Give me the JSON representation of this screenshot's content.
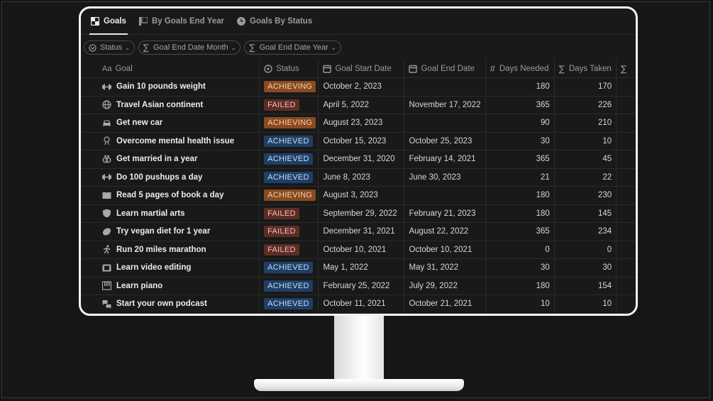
{
  "tabs": [
    {
      "label": "Goals",
      "icon": "table-icon",
      "active": true
    },
    {
      "label": "By Goals End Year",
      "icon": "board-icon",
      "active": false
    },
    {
      "label": "Goals By Status",
      "icon": "clock-icon",
      "active": false
    }
  ],
  "filters": [
    {
      "label": "Status",
      "icon": "status-icon"
    },
    {
      "label": "Goal End Date Month",
      "icon": "sigma-icon"
    },
    {
      "label": "Goal End Date Year",
      "icon": "sigma-icon"
    }
  ],
  "columns": {
    "goal": "Goal",
    "status": "Status",
    "start": "Goal Start Date",
    "end": "Goal End Date",
    "need": "Days Needed",
    "taken": "Days Taken",
    "goal_prefix": "Aa",
    "need_prefix": "#",
    "sigma": "∑"
  },
  "colors": {
    "achieving": "#8a4a1d",
    "achieved": "#1e3f66",
    "failed": "#5e2b26"
  },
  "rows": [
    {
      "icon": "dumbbell-icon",
      "goal": "Gain 10 pounds weight",
      "status": "ACHIEVING",
      "start": "October 2, 2023",
      "end": "",
      "need": "180",
      "taken": "170"
    },
    {
      "icon": "globe-icon",
      "goal": "Travel Asian continent",
      "status": "FAILED",
      "start": "April 5, 2022",
      "end": "November 17, 2022",
      "need": "365",
      "taken": "226"
    },
    {
      "icon": "car-icon",
      "goal": "Get new car",
      "status": "ACHIEVING",
      "start": "August 23, 2023",
      "end": "",
      "need": "90",
      "taken": "210"
    },
    {
      "icon": "brain-icon",
      "goal": "Overcome mental health issue",
      "status": "ACHIEVED",
      "start": "October 15, 2023",
      "end": "October 25, 2023",
      "need": "30",
      "taken": "10"
    },
    {
      "icon": "rings-icon",
      "goal": "Get married in a year",
      "status": "ACHIEVED",
      "start": "December 31, 2020",
      "end": "February 14, 2021",
      "need": "365",
      "taken": "45"
    },
    {
      "icon": "dumbbell-icon",
      "goal": "Do 100 pushups a day",
      "status": "ACHIEVED",
      "start": "June 8, 2023",
      "end": "June 30, 2023",
      "need": "21",
      "taken": "22"
    },
    {
      "icon": "book-icon",
      "goal": "Read 5 pages of book a day",
      "status": "ACHIEVING",
      "start": "August 3, 2023",
      "end": "",
      "need": "180",
      "taken": "230"
    },
    {
      "icon": "shield-icon",
      "goal": "Learn martial arts",
      "status": "FAILED",
      "start": "September 29, 2022",
      "end": "February 21, 2023",
      "need": "180",
      "taken": "145"
    },
    {
      "icon": "leaf-icon",
      "goal": "Try vegan diet for 1 year",
      "status": "FAILED",
      "start": "December 31, 2021",
      "end": "August 22, 2022",
      "need": "365",
      "taken": "234"
    },
    {
      "icon": "runner-icon",
      "goal": "Run 20 miles marathon",
      "status": "FAILED",
      "start": "October 10, 2021",
      "end": "October 10, 2021",
      "need": "0",
      "taken": "0"
    },
    {
      "icon": "film-icon",
      "goal": "Learn video editing",
      "status": "ACHIEVED",
      "start": "May 1, 2022",
      "end": "May 31, 2022",
      "need": "30",
      "taken": "30"
    },
    {
      "icon": "piano-icon",
      "goal": "Learn piano",
      "status": "ACHIEVED",
      "start": "February 25, 2022",
      "end": "July 29, 2022",
      "need": "180",
      "taken": "154"
    },
    {
      "icon": "chat-icon",
      "goal": "Start your own podcast",
      "status": "ACHIEVED",
      "start": "October 11, 2021",
      "end": "October 21, 2021",
      "need": "10",
      "taken": "10"
    }
  ]
}
